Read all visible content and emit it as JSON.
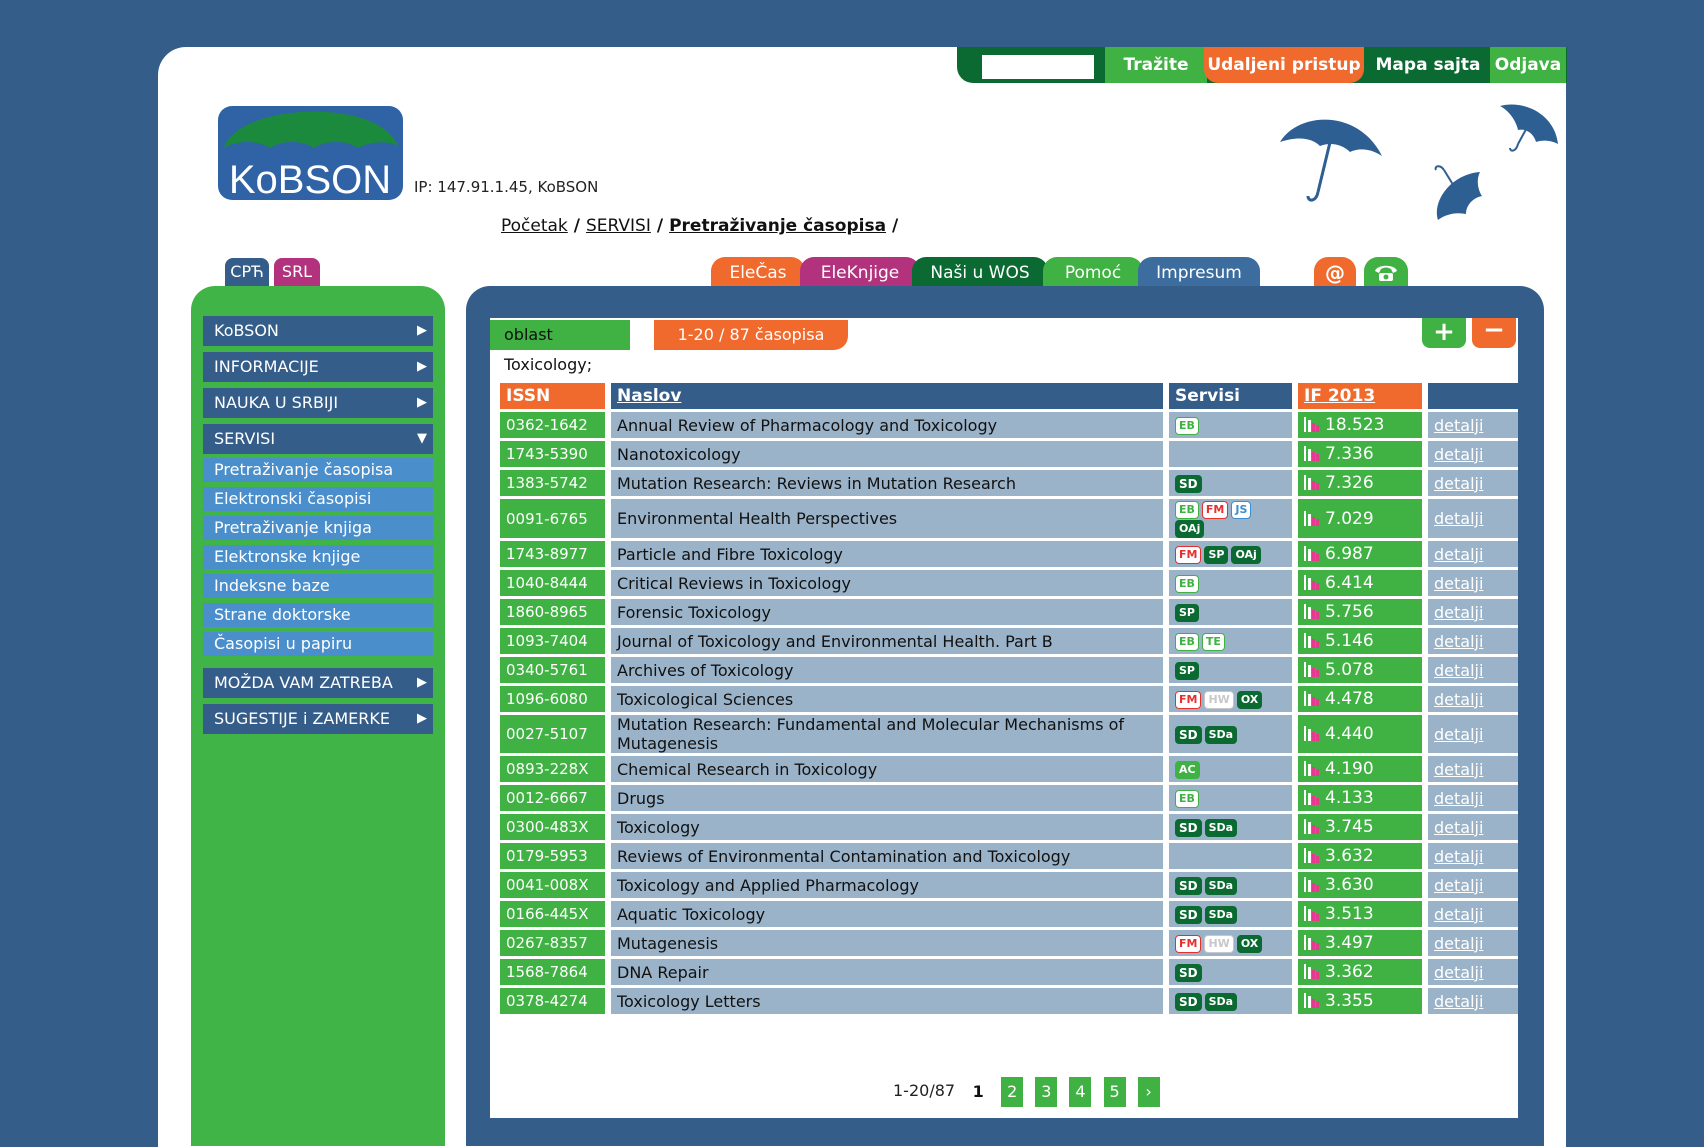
{
  "topbar": {
    "search_value": "",
    "search_label": "Tražite",
    "remote_label": "Udaljeni pristup",
    "sitemap_label": "Mapa sajta",
    "logout_label": "Odjava"
  },
  "header": {
    "logo_text": "KoBSON",
    "ip_text": "IP: 147.91.1.45, KoBSON"
  },
  "breadcrumb": {
    "items": [
      "Početak",
      "SERVISI",
      "Pretraživanje časopisa"
    ]
  },
  "lang": {
    "cyr": "СРЋ",
    "srl": "SRL"
  },
  "tabs": [
    "EleČas",
    "EleKnjige",
    "Naši u WOS",
    "Pomoć",
    "Impresum"
  ],
  "sidebar": {
    "items": [
      "KoBSON",
      "INFORMACIJE",
      "NAUKA U SRBIJI",
      "SERVISI"
    ],
    "sub_items": [
      "Pretraživanje časopisa",
      "Elektronski časopisi",
      "Pretraživanje knjiga",
      "Elektronske knjige",
      "Indeksne baze",
      "Strane doktorske disertacije",
      "Časopisi u papiru"
    ],
    "bottom_items": [
      "MOŽDA VAM ZATREBA",
      "SUGESTIJE i ZAMERKE"
    ]
  },
  "filter": {
    "tag": "oblast Toxicology;",
    "count": "1-20 / 87 časopisa",
    "plus": "+",
    "minus": "−"
  },
  "table": {
    "headers": {
      "issn": "ISSN",
      "naslov": "Naslov",
      "servisi": "Servisi",
      "if": "IF 2013"
    },
    "details_label": "detalji",
    "rows": [
      {
        "issn": "0362-1642",
        "title": "Annual Review of Pharmacology and Toxicology",
        "services": [
          "EB"
        ],
        "if": "18.523"
      },
      {
        "issn": "1743-5390",
        "title": "Nanotoxicology",
        "services": [],
        "if": "7.336"
      },
      {
        "issn": "1383-5742",
        "title": "Mutation Research: Reviews in Mutation Research",
        "services": [
          "SD"
        ],
        "if": "7.326"
      },
      {
        "issn": "0091-6765",
        "title": "Environmental Health Perspectives",
        "services": [
          "EB",
          "FM",
          "JS",
          "OAj"
        ],
        "if": "7.029"
      },
      {
        "issn": "1743-8977",
        "title": "Particle and Fibre Toxicology",
        "services": [
          "FM",
          "SP",
          "OAj"
        ],
        "if": "6.987"
      },
      {
        "issn": "1040-8444",
        "title": "Critical Reviews in Toxicology",
        "services": [
          "EB"
        ],
        "if": "6.414"
      },
      {
        "issn": "1860-8965",
        "title": "Forensic Toxicology",
        "services": [
          "SP"
        ],
        "if": "5.756"
      },
      {
        "issn": "1093-7404",
        "title": "Journal of Toxicology and Environmental Health. Part B",
        "services": [
          "EB",
          "TE"
        ],
        "if": "5.146"
      },
      {
        "issn": "0340-5761",
        "title": "Archives of Toxicology",
        "services": [
          "SP"
        ],
        "if": "5.078"
      },
      {
        "issn": "1096-6080",
        "title": "Toxicological Sciences",
        "services": [
          "FM",
          "HW",
          "OX"
        ],
        "if": "4.478"
      },
      {
        "issn": "0027-5107",
        "title": "Mutation Research: Fundamental and Molecular Mechanisms of Mutagenesis",
        "services": [
          "SD",
          "SDa"
        ],
        "if": "4.440"
      },
      {
        "issn": "0893-228X",
        "title": "Chemical Research in Toxicology",
        "services": [
          "AC"
        ],
        "if": "4.190"
      },
      {
        "issn": "0012-6667",
        "title": "Drugs",
        "services": [
          "EB"
        ],
        "if": "4.133"
      },
      {
        "issn": "0300-483X",
        "title": "Toxicology",
        "services": [
          "SD",
          "SDa"
        ],
        "if": "3.745"
      },
      {
        "issn": "0179-5953",
        "title": "Reviews of Environmental Contamination and Toxicology",
        "services": [],
        "if": "3.632"
      },
      {
        "issn": "0041-008X",
        "title": "Toxicology and Applied Pharmacology",
        "services": [
          "SD",
          "SDa"
        ],
        "if": "3.630"
      },
      {
        "issn": "0166-445X",
        "title": "Aquatic Toxicology",
        "services": [
          "SD",
          "SDa"
        ],
        "if": "3.513"
      },
      {
        "issn": "0267-8357",
        "title": "Mutagenesis",
        "services": [
          "FM",
          "HW",
          "OX"
        ],
        "if": "3.497"
      },
      {
        "issn": "1568-7864",
        "title": "DNA Repair",
        "services": [
          "SD"
        ],
        "if": "3.362"
      },
      {
        "issn": "0378-4274",
        "title": "Toxicology Letters",
        "services": [
          "SD",
          "SDa"
        ],
        "if": "3.355"
      }
    ]
  },
  "pagination": {
    "range": "1-20/87",
    "current": "1",
    "pages": [
      "2",
      "3",
      "4",
      "5"
    ],
    "next": "›"
  },
  "colors": {
    "background": "#345d8a",
    "green": "#3fb243",
    "dark_green": "#0b6a32",
    "orange": "#f06a2d",
    "magenta": "#b2327e",
    "row_gray": "#9ab3c9"
  }
}
